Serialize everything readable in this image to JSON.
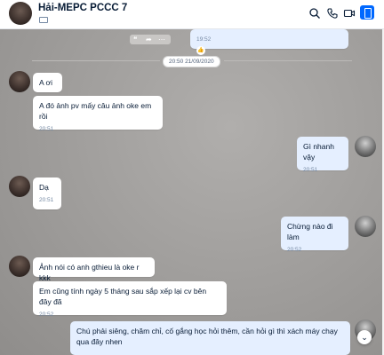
{
  "header": {
    "title": "Hải-MEPC PCCC 7",
    "icons": [
      "search-icon",
      "phone-icon",
      "video-icon",
      "sidebar-toggle-icon"
    ],
    "accent": "#0068ff"
  },
  "chat": {
    "top_message": {
      "time": "19:52"
    },
    "date_separator": "20:50 21/09/2020",
    "messages": [
      {
        "side": "in",
        "text": "A ơi"
      },
      {
        "side": "in",
        "text": "A đó ảnh pv mấy câu ảnh oke em rồi",
        "time": "20:51"
      },
      {
        "side": "out",
        "text": "Gì nhanh vậy",
        "time": "20:51"
      },
      {
        "side": "in",
        "text": "Dạ",
        "time": "20:51"
      },
      {
        "side": "out",
        "text": "Chừng nào đi làm",
        "time": "20:52"
      },
      {
        "side": "in",
        "text": "Ảnh nói có anh gthieu là oke r kkk"
      },
      {
        "side": "in",
        "text": "Em cũng tính ngày 5 tháng sau sắp xếp lại cv bên đây đã",
        "time": "20:52"
      },
      {
        "side": "out",
        "text": "Chú phải siêng, chăm chỉ, cố gắng học hỏi thêm, cần hỏi gì thì xách máy chạy qua đây nhen"
      }
    ]
  }
}
